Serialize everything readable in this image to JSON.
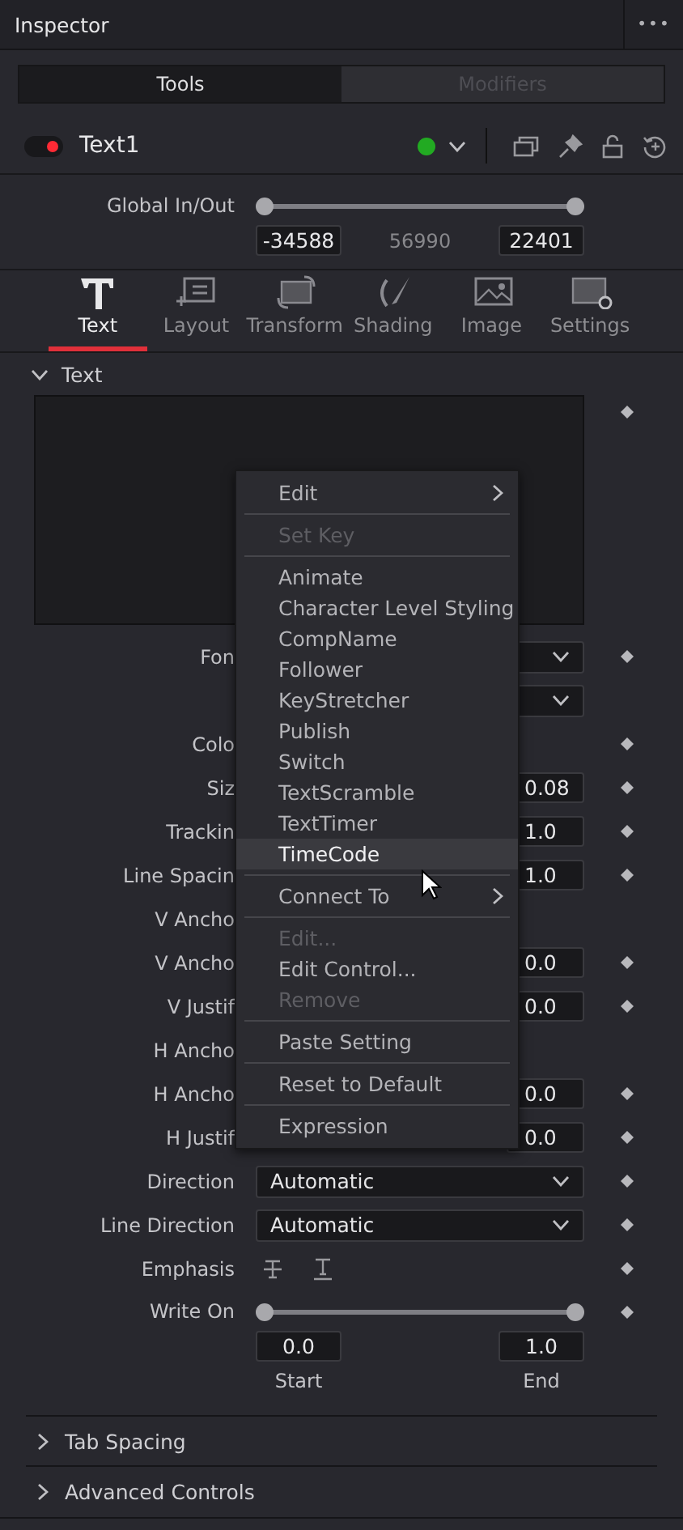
{
  "header": {
    "title": "Inspector",
    "more": "•••"
  },
  "segments": [
    {
      "label": "Tools",
      "selected": true
    },
    {
      "label": "Modifiers",
      "selected": false
    }
  ],
  "tool": {
    "name": "Text1",
    "enabled": true,
    "active": true
  },
  "global_range": {
    "label": "Global In/Out",
    "level": 1,
    "start": "-34588",
    "duration": "56990",
    "end": "22401"
  },
  "tabs": [
    {
      "label": "Text",
      "selected": true
    },
    {
      "label": "Layout",
      "selected": false
    },
    {
      "label": "Transform",
      "selected": false
    },
    {
      "label": "Shading",
      "selected": false
    },
    {
      "label": "Image",
      "selected": false
    },
    {
      "label": "Settings",
      "selected": false
    }
  ],
  "section": {
    "title": "Text",
    "expanded": true
  },
  "params": [
    {
      "kind": "dropdown",
      "label": "Fon",
      "keyframe": true
    },
    {
      "kind": "dropdown",
      "keyframe": false
    },
    {
      "kind": "label",
      "label": "Colo",
      "keyframe": true
    },
    {
      "kind": "number",
      "label": "Siz",
      "value": "0.08",
      "keyframe": true
    },
    {
      "kind": "number",
      "label": "Trackin",
      "value": "1.0",
      "keyframe": true
    },
    {
      "kind": "number",
      "label": "Line Spacin",
      "value": "1.0",
      "keyframe": true
    },
    {
      "kind": "label",
      "label": "V Ancho",
      "keyframe": false
    },
    {
      "kind": "number",
      "label": "V Ancho",
      "value": "0.0",
      "keyframe": true
    },
    {
      "kind": "number",
      "label": "V Justif",
      "value": "0.0",
      "keyframe": true
    },
    {
      "kind": "label",
      "label": "H Ancho",
      "keyframe": false
    },
    {
      "kind": "number",
      "label": "H Ancho",
      "value": "0.0",
      "keyframe": true
    },
    {
      "kind": "number",
      "label": "H Justif",
      "value": "0.0",
      "keyframe": true
    },
    {
      "kind": "dropdown",
      "label": "Direction",
      "value": "Automatic",
      "keyframe": true
    },
    {
      "kind": "dropdown",
      "label": "Line Direction",
      "value": "Automatic",
      "keyframe": true
    },
    {
      "kind": "emphasis",
      "label": "Emphasis",
      "keyframe": true
    }
  ],
  "write_on": {
    "label": "Write On",
    "level": 1,
    "start": "0.0",
    "end": "1.0",
    "start_label": "Start",
    "end_label": "End"
  },
  "collapsed_sections": [
    {
      "title": "Tab Spacing",
      "expanded": false
    },
    {
      "title": "Advanced Controls",
      "expanded": false
    }
  ],
  "context_menu": [
    {
      "kind": "item",
      "label": "Edit",
      "submenu": true,
      "disabled": false,
      "highlighted": false
    },
    {
      "kind": "separator"
    },
    {
      "kind": "item",
      "label": "Set Key",
      "submenu": false,
      "disabled": true,
      "highlighted": false
    },
    {
      "kind": "separator"
    },
    {
      "kind": "item",
      "label": "Animate",
      "submenu": false,
      "disabled": false,
      "highlighted": false
    },
    {
      "kind": "item",
      "label": "Character Level Styling",
      "submenu": false,
      "disabled": false,
      "highlighted": false
    },
    {
      "kind": "item",
      "label": "CompName",
      "submenu": false,
      "disabled": false,
      "highlighted": false
    },
    {
      "kind": "item",
      "label": "Follower",
      "submenu": false,
      "disabled": false,
      "highlighted": false
    },
    {
      "kind": "item",
      "label": "KeyStretcher",
      "submenu": false,
      "disabled": false,
      "highlighted": false
    },
    {
      "kind": "item",
      "label": "Publish",
      "submenu": false,
      "disabled": false,
      "highlighted": false
    },
    {
      "kind": "item",
      "label": "Switch",
      "submenu": false,
      "disabled": false,
      "highlighted": false
    },
    {
      "kind": "item",
      "label": "TextScramble",
      "submenu": false,
      "disabled": false,
      "highlighted": false
    },
    {
      "kind": "item",
      "label": "TextTimer",
      "submenu": false,
      "disabled": false,
      "highlighted": false
    },
    {
      "kind": "item",
      "label": "TimeCode",
      "submenu": false,
      "disabled": false,
      "highlighted": true
    },
    {
      "kind": "separator"
    },
    {
      "kind": "item",
      "label": "Connect To",
      "submenu": true,
      "disabled": false,
      "highlighted": false
    },
    {
      "kind": "separator"
    },
    {
      "kind": "item",
      "label": "Edit...",
      "submenu": false,
      "disabled": true,
      "highlighted": false
    },
    {
      "kind": "item",
      "label": "Edit Control...",
      "submenu": false,
      "disabled": false,
      "highlighted": false
    },
    {
      "kind": "item",
      "label": "Remove",
      "submenu": false,
      "disabled": true,
      "highlighted": false
    },
    {
      "kind": "separator"
    },
    {
      "kind": "item",
      "label": "Paste Setting",
      "submenu": false,
      "disabled": false,
      "highlighted": false
    },
    {
      "kind": "separator"
    },
    {
      "kind": "item",
      "label": "Reset to Default",
      "submenu": false,
      "disabled": false,
      "highlighted": false
    },
    {
      "kind": "separator"
    },
    {
      "kind": "item",
      "label": "Expression",
      "submenu": false,
      "disabled": false,
      "highlighted": false
    }
  ]
}
